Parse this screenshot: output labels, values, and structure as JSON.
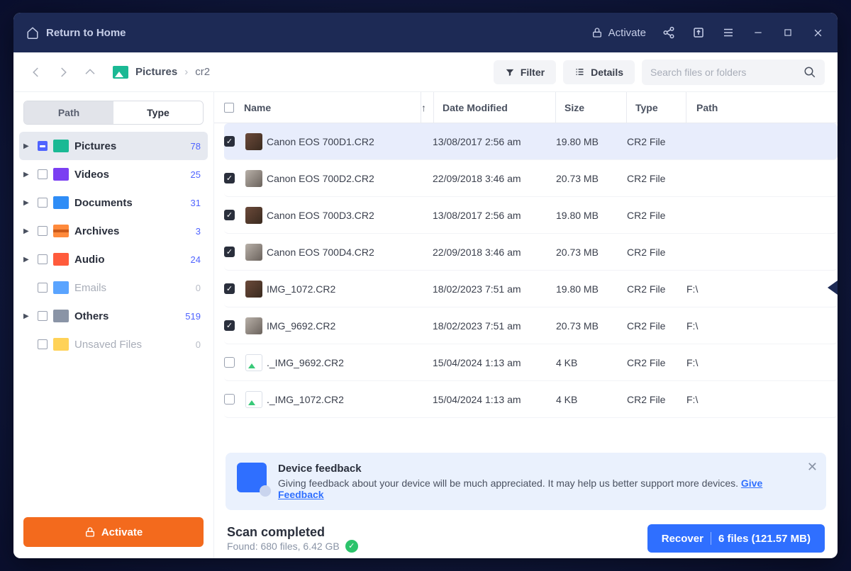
{
  "titlebar": {
    "return": "Return to Home",
    "activate": "Activate"
  },
  "toolbar": {
    "filter": "Filter",
    "details": "Details"
  },
  "breadcrumb": {
    "root": "Pictures",
    "current": "cr2"
  },
  "search": {
    "placeholder": "Search files or folders"
  },
  "tabs": {
    "path": "Path",
    "type": "Type"
  },
  "sidebar": {
    "items": [
      {
        "label": "Pictures",
        "count": "78"
      },
      {
        "label": "Videos",
        "count": "25"
      },
      {
        "label": "Documents",
        "count": "31"
      },
      {
        "label": "Archives",
        "count": "3"
      },
      {
        "label": "Audio",
        "count": "24"
      },
      {
        "label": "Emails",
        "count": "0"
      },
      {
        "label": "Others",
        "count": "519"
      },
      {
        "label": "Unsaved Files",
        "count": "0"
      }
    ],
    "activate": "Activate"
  },
  "columns": {
    "name": "Name",
    "date": "Date Modified",
    "size": "Size",
    "type": "Type",
    "path": "Path"
  },
  "rows": [
    {
      "name": "Canon EOS 700D1.CR2",
      "date": "13/08/2017 2:56 am",
      "size": "19.80 MB",
      "type": "CR2 File",
      "path": ""
    },
    {
      "name": "Canon EOS 700D2.CR2",
      "date": "22/09/2018 3:46 am",
      "size": "20.73 MB",
      "type": "CR2 File",
      "path": ""
    },
    {
      "name": "Canon EOS 700D3.CR2",
      "date": "13/08/2017 2:56 am",
      "size": "19.80 MB",
      "type": "CR2 File",
      "path": ""
    },
    {
      "name": "Canon EOS 700D4.CR2",
      "date": "22/09/2018 3:46 am",
      "size": "20.73 MB",
      "type": "CR2 File",
      "path": ""
    },
    {
      "name": "IMG_1072.CR2",
      "date": "18/02/2023 7:51 am",
      "size": "19.80 MB",
      "type": "CR2 File",
      "path": "F:\\"
    },
    {
      "name": "IMG_9692.CR2",
      "date": "18/02/2023 7:51 am",
      "size": "20.73 MB",
      "type": "CR2 File",
      "path": "F:\\"
    },
    {
      "name": "._IMG_9692.CR2",
      "date": "15/04/2024 1:13 am",
      "size": "4 KB",
      "type": "CR2 File",
      "path": "F:\\"
    },
    {
      "name": "._IMG_1072.CR2",
      "date": "15/04/2024 1:13 am",
      "size": "4 KB",
      "type": "CR2 File",
      "path": "F:\\"
    }
  ],
  "feedback": {
    "title": "Device feedback",
    "body": "Giving feedback about your device will be much appreciated. It may help us better support more devices. ",
    "link": "Give Feedback"
  },
  "status": {
    "title": "Scan completed",
    "subtitle": "Found: 680 files, 6.42 GB"
  },
  "recover": {
    "label": "Recover",
    "summary": "6 files (121.57 MB)"
  }
}
